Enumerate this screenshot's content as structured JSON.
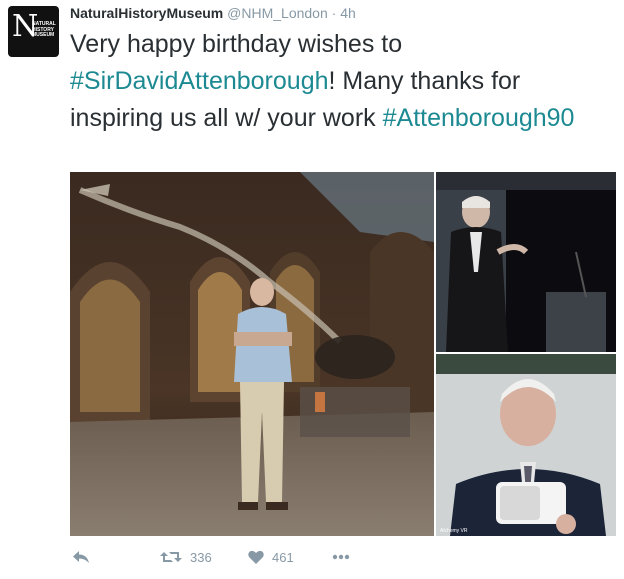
{
  "account": {
    "display_name": "NaturalHistoryMuseum",
    "handle": "@NHM_London",
    "separator": "·",
    "time": "4h",
    "avatar_letter": "N",
    "avatar_text": [
      "NATURAL",
      "HISTORY",
      "MUSEUM"
    ]
  },
  "tweet": {
    "text_part1": "Very happy birthday wishes to",
    "hashtag1": "#SirDavidAttenborough",
    "text_part2": "! Many thanks for inspiring us all w/ your work",
    "hashtag2": "#Attenborough90"
  },
  "photos": {
    "watermark": "Alchemy VR"
  },
  "actions": {
    "retweet_count": "336",
    "like_count": "461",
    "more_icon": "ellipsis-icon"
  },
  "colors": {
    "hashtag": "#1d8a93",
    "muted": "#8899a6",
    "text": "#292f33"
  }
}
